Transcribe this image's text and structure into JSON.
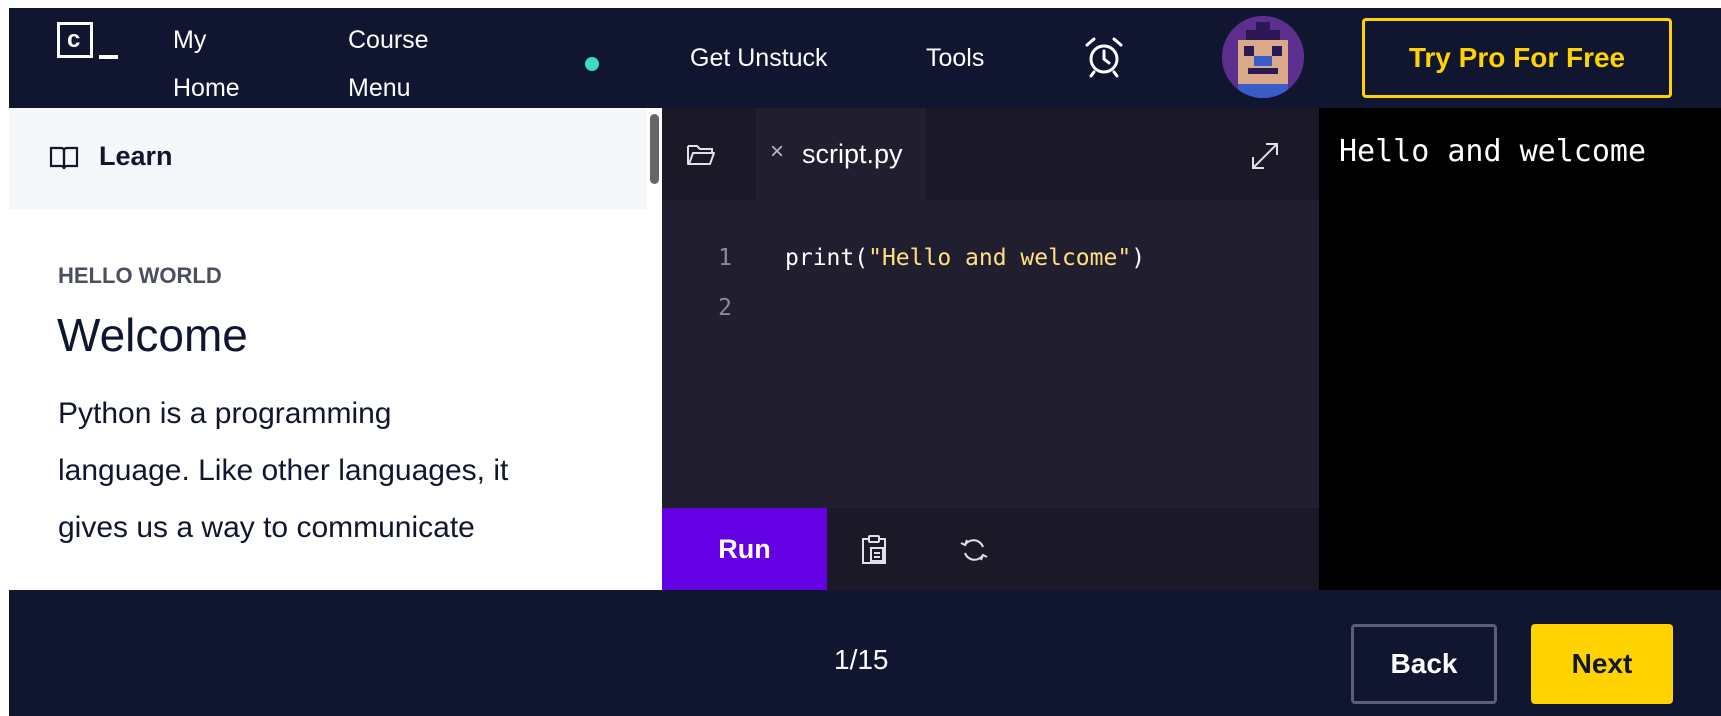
{
  "header": {
    "logo_letter": "c",
    "nav": {
      "my_home": [
        "My",
        "Home"
      ],
      "course_menu": [
        "Course",
        "Menu"
      ],
      "get_unstuck": "Get Unstuck",
      "tools": "Tools"
    },
    "status_dot_color": "#3ad9c9",
    "alarm_icon": "alarm-clock-icon",
    "avatar": "pixel-avatar",
    "try_pro_label": "Try Pro For Free"
  },
  "learn": {
    "icon": "book-icon",
    "title": "Learn",
    "eyebrow": "HELLO WORLD",
    "lesson_title": "Welcome",
    "body_lines": [
      "Python is a programming",
      "language. Like other languages, it",
      "gives us a way to communicate"
    ]
  },
  "editor": {
    "folder_icon": "folder-icon",
    "close_icon": "×",
    "tab_label": "script.py",
    "expand_icon": "expand-icon",
    "lines": [
      {
        "number": "1",
        "prefix": "print(",
        "string": "\"Hello and welcome\"",
        "suffix": ")"
      },
      {
        "number": "2",
        "prefix": "",
        "string": "",
        "suffix": ""
      }
    ],
    "run_label": "Run",
    "clipboard_icon": "clipboard-icon",
    "refresh_icon": "refresh-icon"
  },
  "output": {
    "text": "Hello and welcome"
  },
  "footer": {
    "progress": "1/15",
    "back_label": "Back",
    "next_label": "Next"
  },
  "colors": {
    "navy": "#10162f",
    "brand_yellow": "#ffd300",
    "run_purple": "#6400e4",
    "editor_bg": "#211e2f",
    "string_color": "#ffe083"
  }
}
